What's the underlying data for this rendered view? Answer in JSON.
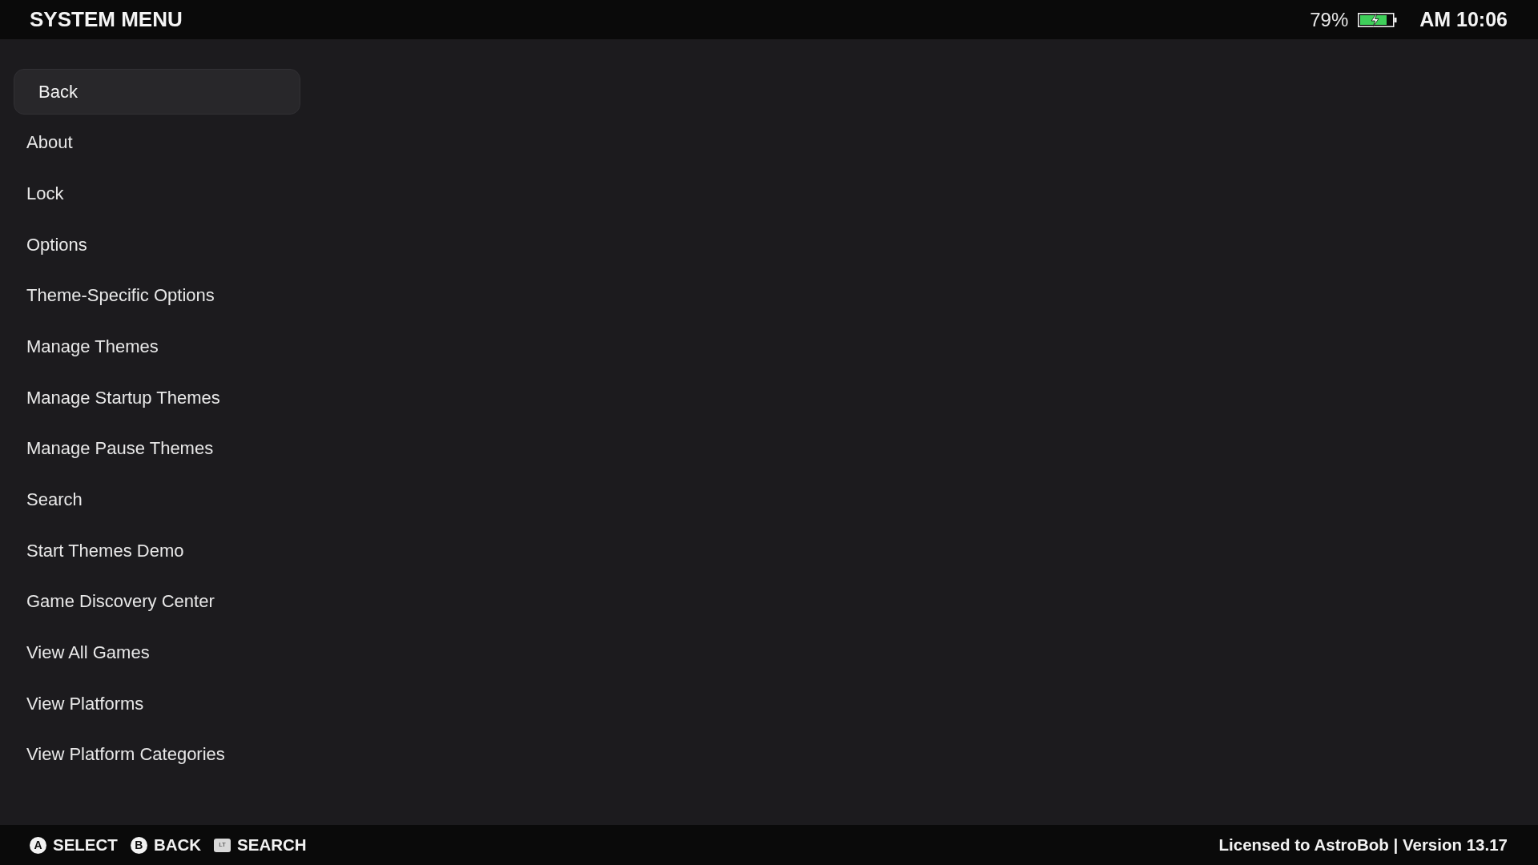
{
  "header": {
    "title": "SYSTEM MENU",
    "battery_percent": "79%",
    "time": "AM 10:06"
  },
  "menu": {
    "items": [
      {
        "label": "Back",
        "selected": true
      },
      {
        "label": "About",
        "selected": false
      },
      {
        "label": "Lock",
        "selected": false
      },
      {
        "label": "Options",
        "selected": false
      },
      {
        "label": "Theme-Specific Options",
        "selected": false
      },
      {
        "label": "Manage Themes",
        "selected": false
      },
      {
        "label": "Manage Startup Themes",
        "selected": false
      },
      {
        "label": "Manage Pause Themes",
        "selected": false
      },
      {
        "label": "Search",
        "selected": false
      },
      {
        "label": "Start Themes Demo",
        "selected": false
      },
      {
        "label": "Game Discovery Center",
        "selected": false
      },
      {
        "label": "View All Games",
        "selected": false
      },
      {
        "label": "View Platforms",
        "selected": false
      },
      {
        "label": "View Platform Categories",
        "selected": false
      }
    ]
  },
  "footer": {
    "hints": [
      {
        "kind": "face",
        "button": "A",
        "label": "SELECT"
      },
      {
        "kind": "face",
        "button": "B",
        "label": "BACK"
      },
      {
        "kind": "trigger",
        "button": "LT",
        "label": "SEARCH"
      }
    ],
    "license": "Licensed to AstroBob | Version 13.17"
  }
}
